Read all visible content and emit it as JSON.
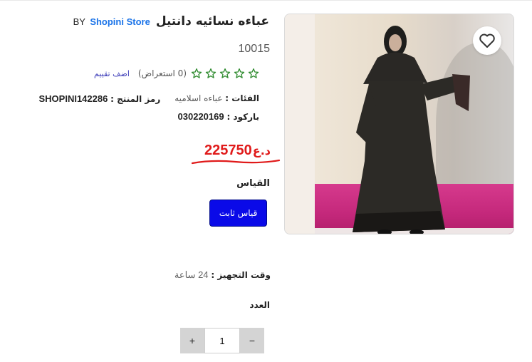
{
  "product": {
    "title": "عباءه نسائيه دانتيل",
    "by_label": "BY",
    "store_name": "Shopini Store",
    "number": "10015"
  },
  "rating": {
    "stars": 5,
    "filled": 0,
    "reviews_text": "(0 استعراض)",
    "add_rating_label": "اضف تقييم",
    "star_color": "#2e8b2e"
  },
  "meta": {
    "category_label": "الفئات :",
    "category_value": "عباءه اسلاميه",
    "sku_label": "رمز المنتج :",
    "sku_value": "SHOPINI142286",
    "barcode_label": "باركود :",
    "barcode_value": "030220169"
  },
  "price": {
    "currency": "د.ع",
    "amount": "225750",
    "color": "#e01a1a"
  },
  "size": {
    "label": "القياس",
    "option_label": "قياس ثابت",
    "button_color": "#0a0ae8"
  },
  "preparation": {
    "label": "وقت التجهيز :",
    "value": "24 ساعة"
  },
  "quantity": {
    "label": "العدد",
    "value": "1",
    "plus": "+",
    "minus": "−"
  },
  "icons": {
    "favorite": "heart-icon",
    "star": "star-outline-icon"
  }
}
